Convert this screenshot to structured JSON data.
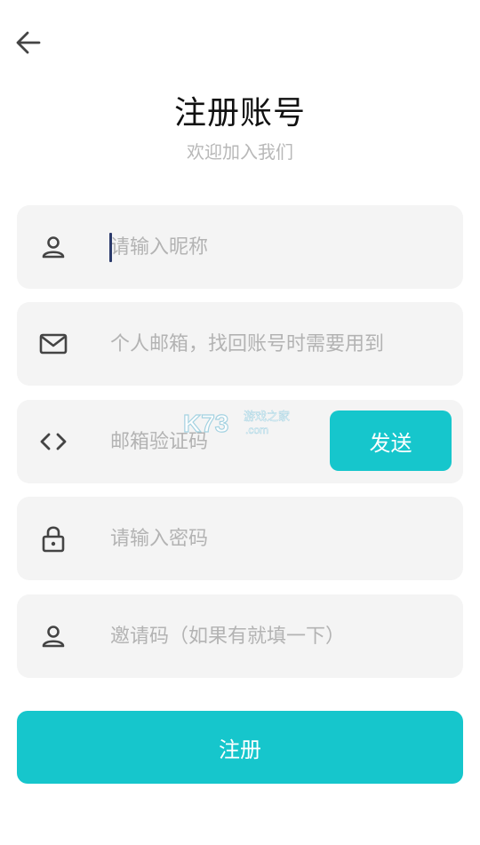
{
  "header": {
    "title": "注册账号",
    "subtitle": "欢迎加入我们"
  },
  "form": {
    "nickname": {
      "placeholder": "请输入昵称",
      "icon": "person-icon"
    },
    "email": {
      "placeholder": "个人邮箱，找回账号时需要用到",
      "icon": "mail-icon"
    },
    "code": {
      "placeholder": "邮箱验证码",
      "icon": "code-icon",
      "send_label": "发送"
    },
    "password": {
      "placeholder": "请输入密码",
      "icon": "lock-icon"
    },
    "invite": {
      "placeholder": "邀请码（如果有就填一下）",
      "icon": "person-icon"
    }
  },
  "register_label": "注册",
  "watermark": {
    "brand": "K73",
    "tagline": "游戏之家",
    "domain": ".com"
  },
  "colors": {
    "accent": "#16c6cc",
    "field_bg": "#f4f4f4",
    "placeholder": "#b3b3b3",
    "icon": "#444444"
  }
}
